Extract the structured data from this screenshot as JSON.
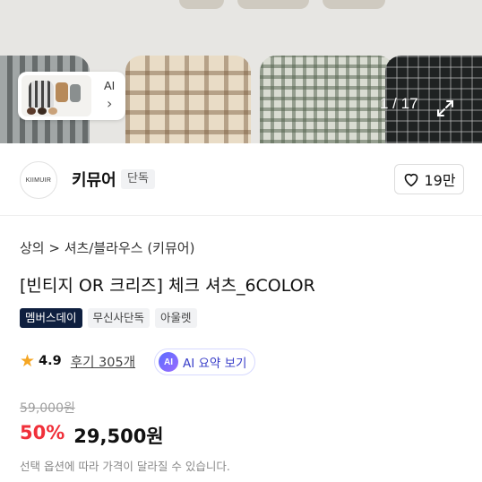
{
  "gallery": {
    "ai_chip": {
      "label": "AI",
      "arrow": "›"
    },
    "counter": "1 / 17",
    "expand_icon": "expand-icon"
  },
  "store": {
    "logo_text": "KIIMUIR",
    "name": "키뮤어",
    "exclusive_badge": "단독",
    "likes": "19만"
  },
  "product": {
    "breadcrumb": "상의 > 셔츠/블라우스 (키뮤어)",
    "title": "[빈티지 OR 크리즈] 체크 셔츠_6COLOR",
    "tags": [
      "멤버스데이",
      "무신사단독",
      "아울렛"
    ],
    "rating": "4.9",
    "reviews": "후기 305개",
    "ai_summary": {
      "badge": "AI",
      "label": "AI 요약 보기"
    },
    "original_price": "59,000원",
    "discount": "50%",
    "sale_price": "29,500원",
    "note": "선택 옵션에 따라 가격이 달라질 수 있습니다."
  },
  "colors": {
    "accent_red": "#f0303a",
    "member_tag": "#0e1f3f",
    "star": "#f5a623"
  }
}
